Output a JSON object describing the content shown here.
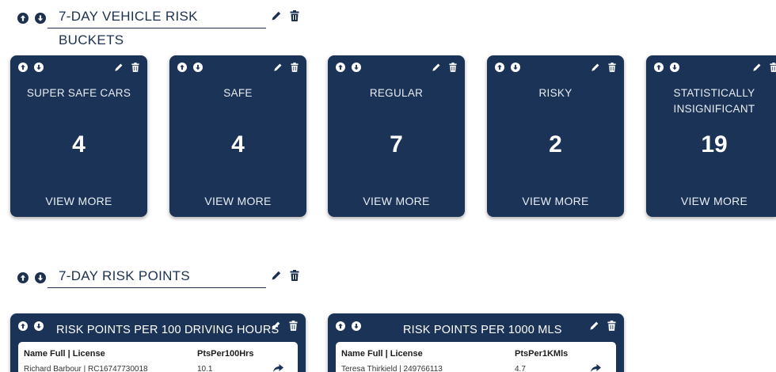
{
  "section1": {
    "title": "7-DAY VEHICLE RISK BUCKETS"
  },
  "buckets": [
    {
      "label": "SUPER SAFE CARS",
      "count": "4",
      "action": "VIEW MORE"
    },
    {
      "label": "SAFE",
      "count": "4",
      "action": "VIEW MORE"
    },
    {
      "label": "REGULAR",
      "count": "7",
      "action": "VIEW MORE"
    },
    {
      "label": "RISKY",
      "count": "2",
      "action": "VIEW MORE"
    },
    {
      "label": "STATISTICALLY INSIGNIFICANT",
      "count": "19",
      "action": "VIEW MORE"
    }
  ],
  "section2": {
    "title": "7-DAY RISK POINTS"
  },
  "panels": [
    {
      "title": "RISK POINTS PER 100 DRIVING HOURS",
      "col_name": "Name Full | License",
      "col_value": "PtsPer100Hrs",
      "rows": [
        {
          "name": "Richard Barbour | RC16747730018",
          "value": "10.1"
        }
      ]
    },
    {
      "title": "RISK POINTS PER 1000 MLS",
      "col_name": "Name Full | License",
      "col_value": "PtsPer1KMls",
      "rows": [
        {
          "name": "Teresa Thirkield | 249766113",
          "value": "4.7"
        }
      ]
    }
  ],
  "colors": {
    "card_bg": "#1b3357",
    "text_dark": "#1c3150"
  }
}
